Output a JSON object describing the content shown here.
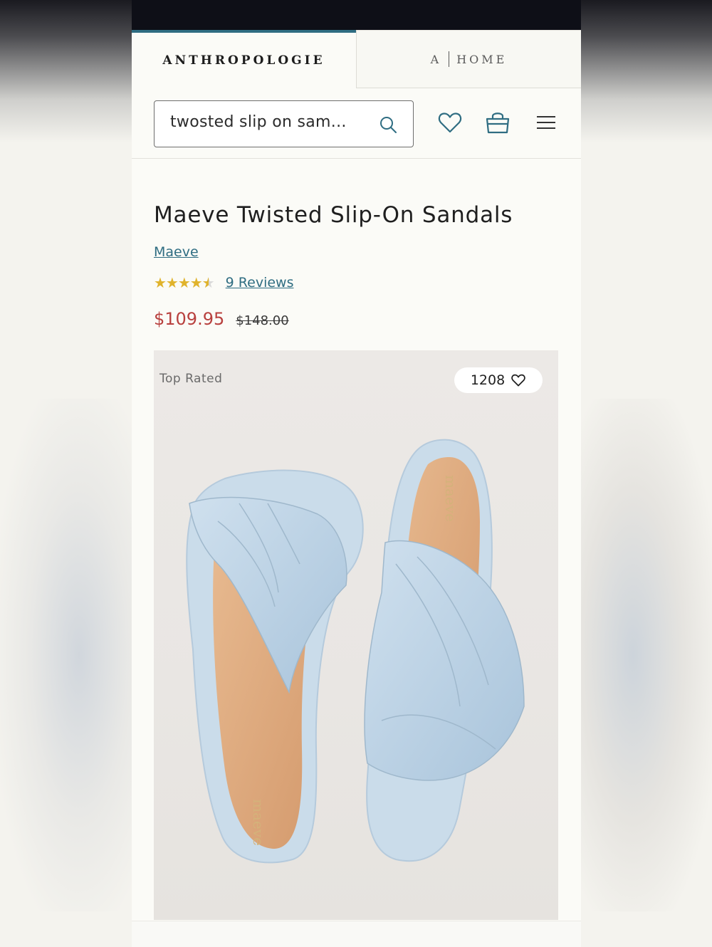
{
  "tabs": [
    {
      "label": "ANTHROPOLOGIE"
    },
    {
      "prefix": "A",
      "label": "HOME"
    }
  ],
  "search": {
    "value": "twosted slip on sam..."
  },
  "product": {
    "title": "Maeve Twisted Slip-On Sandals",
    "brand": "Maeve",
    "rating": 4.5,
    "reviews_label": "9 Reviews",
    "sale_price": "$109.95",
    "original_price": "$148.00",
    "badge": "Top Rated",
    "favorites_count": "1208",
    "insole_logo": "maeve"
  },
  "colors": {
    "accent": "#2f6d82",
    "sale": "#b8403e",
    "star": "#e0b32c"
  },
  "icons": [
    "search-icon",
    "heart-icon",
    "shopping-bag-icon",
    "menu-icon"
  ]
}
